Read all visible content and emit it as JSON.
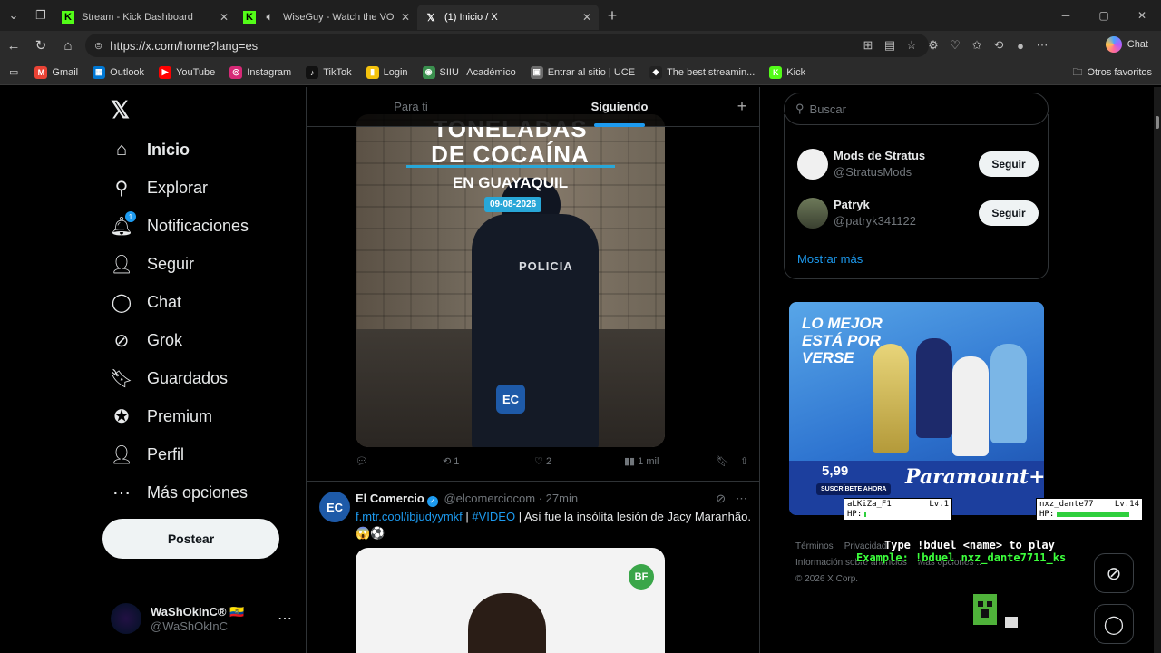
{
  "browser": {
    "tabs": [
      {
        "title": "Stream - Kick Dashboard",
        "icon": "kick-icon",
        "active": false
      },
      {
        "title": "WiseGuy - Watch the VOD on",
        "icon": "kick-icon",
        "active": false
      },
      {
        "title": "(1) Inicio / X",
        "icon": "x-icon",
        "active": true
      }
    ],
    "url": "https://x.com/home?lang=es",
    "chat_label": "Chat",
    "bookmarks": [
      {
        "label": "Gmail",
        "color": "#ea4335",
        "glyph": "M"
      },
      {
        "label": "Outlook",
        "color": "#0078d4",
        "glyph": "▦"
      },
      {
        "label": "YouTube",
        "color": "#ff0000",
        "glyph": "▶"
      },
      {
        "label": "Instagram",
        "color": "#d62976",
        "glyph": "◎"
      },
      {
        "label": "TikTok",
        "color": "#111111",
        "glyph": "♪"
      },
      {
        "label": "Login",
        "color": "#f4c20d",
        "glyph": "▮"
      },
      {
        "label": "SIIU | Académico",
        "color": "#3a8f4e",
        "glyph": "◉"
      },
      {
        "label": "Entrar al sitio | UCE",
        "color": "#6d6d6d",
        "glyph": "▣"
      },
      {
        "label": "The best streamin...",
        "color": "#222222",
        "glyph": "◆"
      },
      {
        "label": "Kick",
        "color": "#53fc18",
        "glyph": "K"
      }
    ],
    "other_bookmarks": "Otros favoritos"
  },
  "sidebar": {
    "logo": "𝕏",
    "items": [
      {
        "label": "Inicio",
        "icon": "home-icon",
        "glyph": "⌂"
      },
      {
        "label": "Explorar",
        "icon": "search-icon",
        "glyph": "⚲"
      },
      {
        "label": "Notificaciones",
        "icon": "bell-icon",
        "glyph": "🔔︎"
      },
      {
        "label": "Seguir",
        "icon": "follow-icon",
        "glyph": "👤︎"
      },
      {
        "label": "Chat",
        "icon": "chat-icon",
        "glyph": "◯"
      },
      {
        "label": "Grok",
        "icon": "grok-icon",
        "glyph": "⊘"
      },
      {
        "label": "Guardados",
        "icon": "bookmark-icon",
        "glyph": "🔖︎"
      },
      {
        "label": "Premium",
        "icon": "premium-icon",
        "glyph": "✪"
      },
      {
        "label": "Perfil",
        "icon": "profile-icon",
        "glyph": "👤︎"
      },
      {
        "label": "Más opciones",
        "icon": "more-icon",
        "glyph": "⋯"
      }
    ],
    "notification_count": "1",
    "post_button": "Postear",
    "account": {
      "name": "WaShOkInC® 🇪🇨",
      "handle": "@WaShOkInC"
    }
  },
  "feed": {
    "tabs": [
      "Para ti",
      "Siguiendo"
    ],
    "tweet1": {
      "media": {
        "headline1": "TONELADAS",
        "headline1b": "DE COCAÍNA",
        "headline2": "EN GUAYAQUIL",
        "date": "09-08-2026",
        "badge": "POLICIA",
        "logo": "EC"
      },
      "retweets": "1",
      "likes": "2",
      "views": "1 mil"
    },
    "tweet2": {
      "avatar": "EC",
      "name": "El Comercio",
      "handle": "@elcomerciocom",
      "time": "· 27min",
      "link": "f.mtr.cool/ibjudyymkf",
      "hashtag": "#VIDEO",
      "text": "| Así fue la insólita lesión de Jacy Maranhão.",
      "emoji": "😱⚽",
      "media_logo": "BF"
    }
  },
  "right": {
    "search_placeholder": "Buscar",
    "who_to_follow": [
      {
        "name": "Mods de Stratus",
        "handle": "@StratusMods",
        "button": "Seguir"
      },
      {
        "name": "Patryk",
        "handle": "@patryk341122",
        "button": "Seguir"
      }
    ],
    "show_more": "Mostrar más",
    "ad": {
      "headline1": "LO MEJOR",
      "headline2": "ESTÁ POR",
      "headline3": "VERSE",
      "price": "5,99",
      "cta": "SUSCRÍBETE AHORA",
      "brand": "Paramount+"
    },
    "footer": {
      "terms": "Términos",
      "privacy": "Privacidad",
      "ads_info": "Información sobre anuncios",
      "more": "Más opciones ...",
      "copyright": "© 2026 X Corp."
    }
  },
  "overlay": {
    "player1": {
      "name": "aLKiZa_F1",
      "level": "Lv.1",
      "hp_label": "HP:",
      "hp": 0.0
    },
    "player2": {
      "name": "nxz_dante77",
      "level": "Lv.14",
      "hp_label": "HP:",
      "hp": 1.0
    },
    "line1": "Type !bduel <name> to play",
    "line2": "Example: !bduel nxz_dante7711_ks"
  }
}
